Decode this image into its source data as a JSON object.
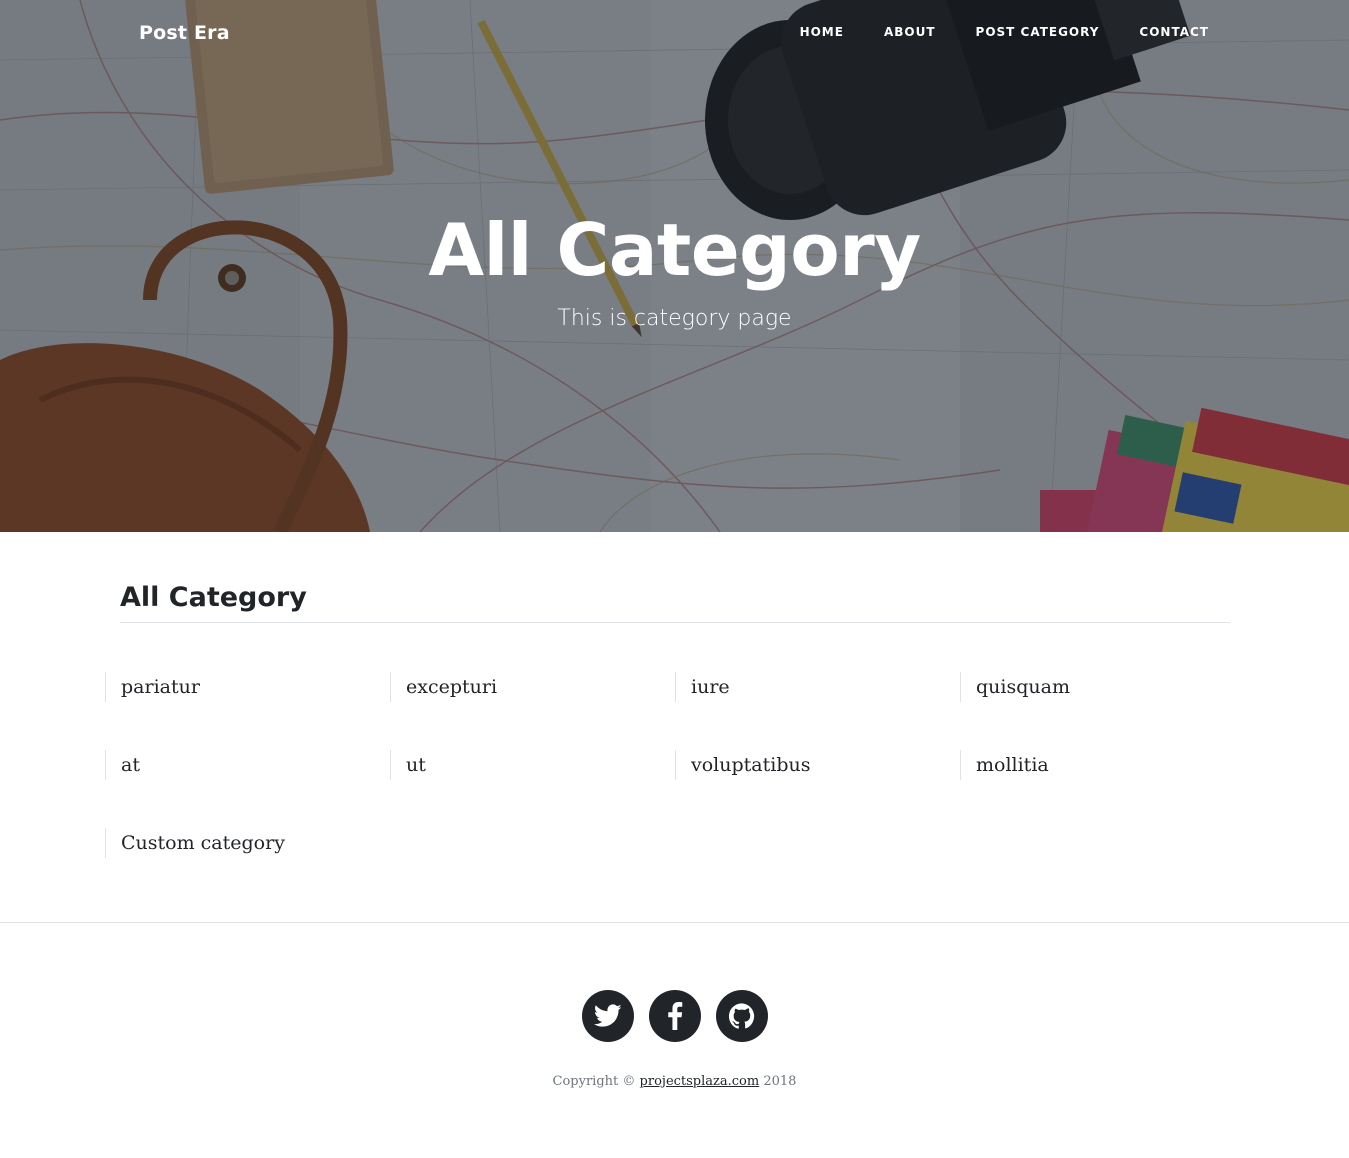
{
  "brand": "Post Era",
  "nav": {
    "home": "Home",
    "about": "About",
    "post_category": "Post Category",
    "contact": "Contact"
  },
  "hero": {
    "title": "All Category",
    "subtitle": "This is category page"
  },
  "main": {
    "section_title": "All Category",
    "categories": [
      "pariatur",
      "excepturi",
      "iure",
      "quisquam",
      "at",
      "ut",
      "voluptatibus",
      "mollitia",
      "Custom category"
    ]
  },
  "footer": {
    "social": [
      {
        "name": "twitter-icon"
      },
      {
        "name": "facebook-icon"
      },
      {
        "name": "github-icon"
      }
    ],
    "copyright_prefix": "Copyright ©",
    "copyright_link": "projectsplaza.com",
    "copyright_year": "2018"
  },
  "colors": {
    "dark": "#212529",
    "muted": "#6c757d",
    "rule": "#dee2e6",
    "hero_text": "#ffffff"
  }
}
